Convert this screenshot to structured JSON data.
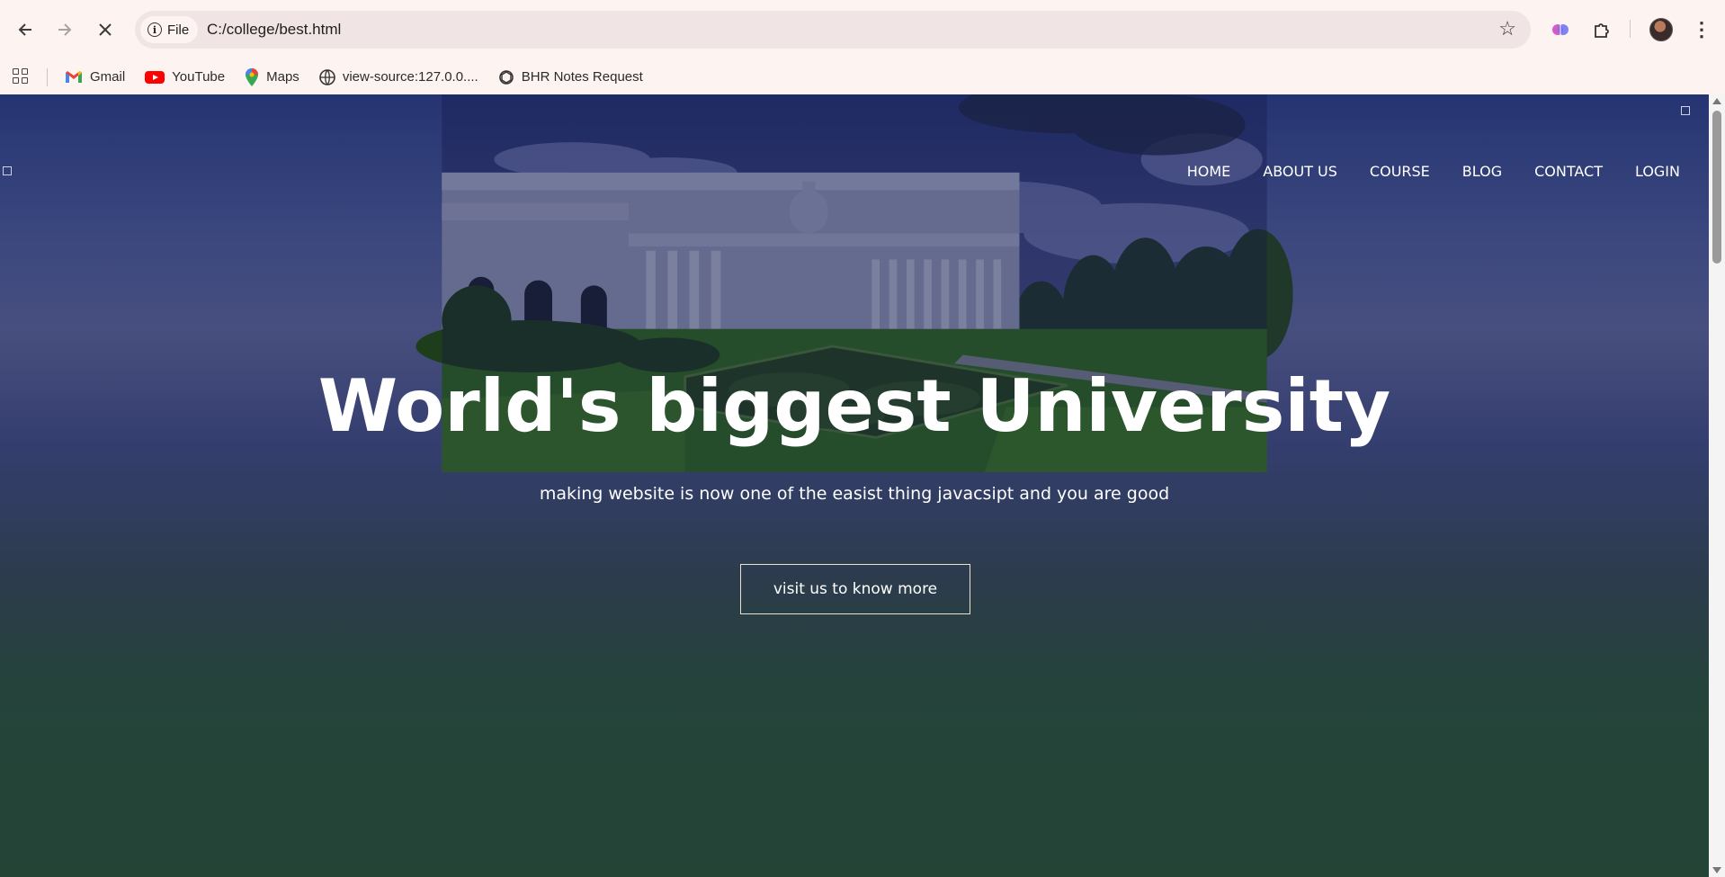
{
  "browser": {
    "back_icon": "arrow-left-icon",
    "forward_icon": "arrow-right-icon",
    "stop_icon": "close-icon",
    "chip_label": "File",
    "url": "C:/college/best.html",
    "bookmarks": [
      {
        "label": "Gmail",
        "icon": "gmail-icon"
      },
      {
        "label": "YouTube",
        "icon": "youtube-icon"
      },
      {
        "label": "Maps",
        "icon": "maps-icon"
      },
      {
        "label": "view-source:127.0.0....",
        "icon": "globe-icon"
      },
      {
        "label": "BHR Notes Request",
        "icon": "openai-icon"
      }
    ]
  },
  "site": {
    "nav": [
      "HOME",
      "ABOUT US",
      "COURSE",
      "BLOG",
      "CONTACT",
      "LOGIN"
    ],
    "hero_title": "World's biggest University",
    "hero_subtitle": "making website is now one of the easist thing javacsipt and you are good",
    "cta_label": "visit us to know more"
  },
  "colors": {
    "chrome_bg": "#fdf3f1",
    "omnibox_bg": "#f1e4e4",
    "overlay": "#121646"
  }
}
